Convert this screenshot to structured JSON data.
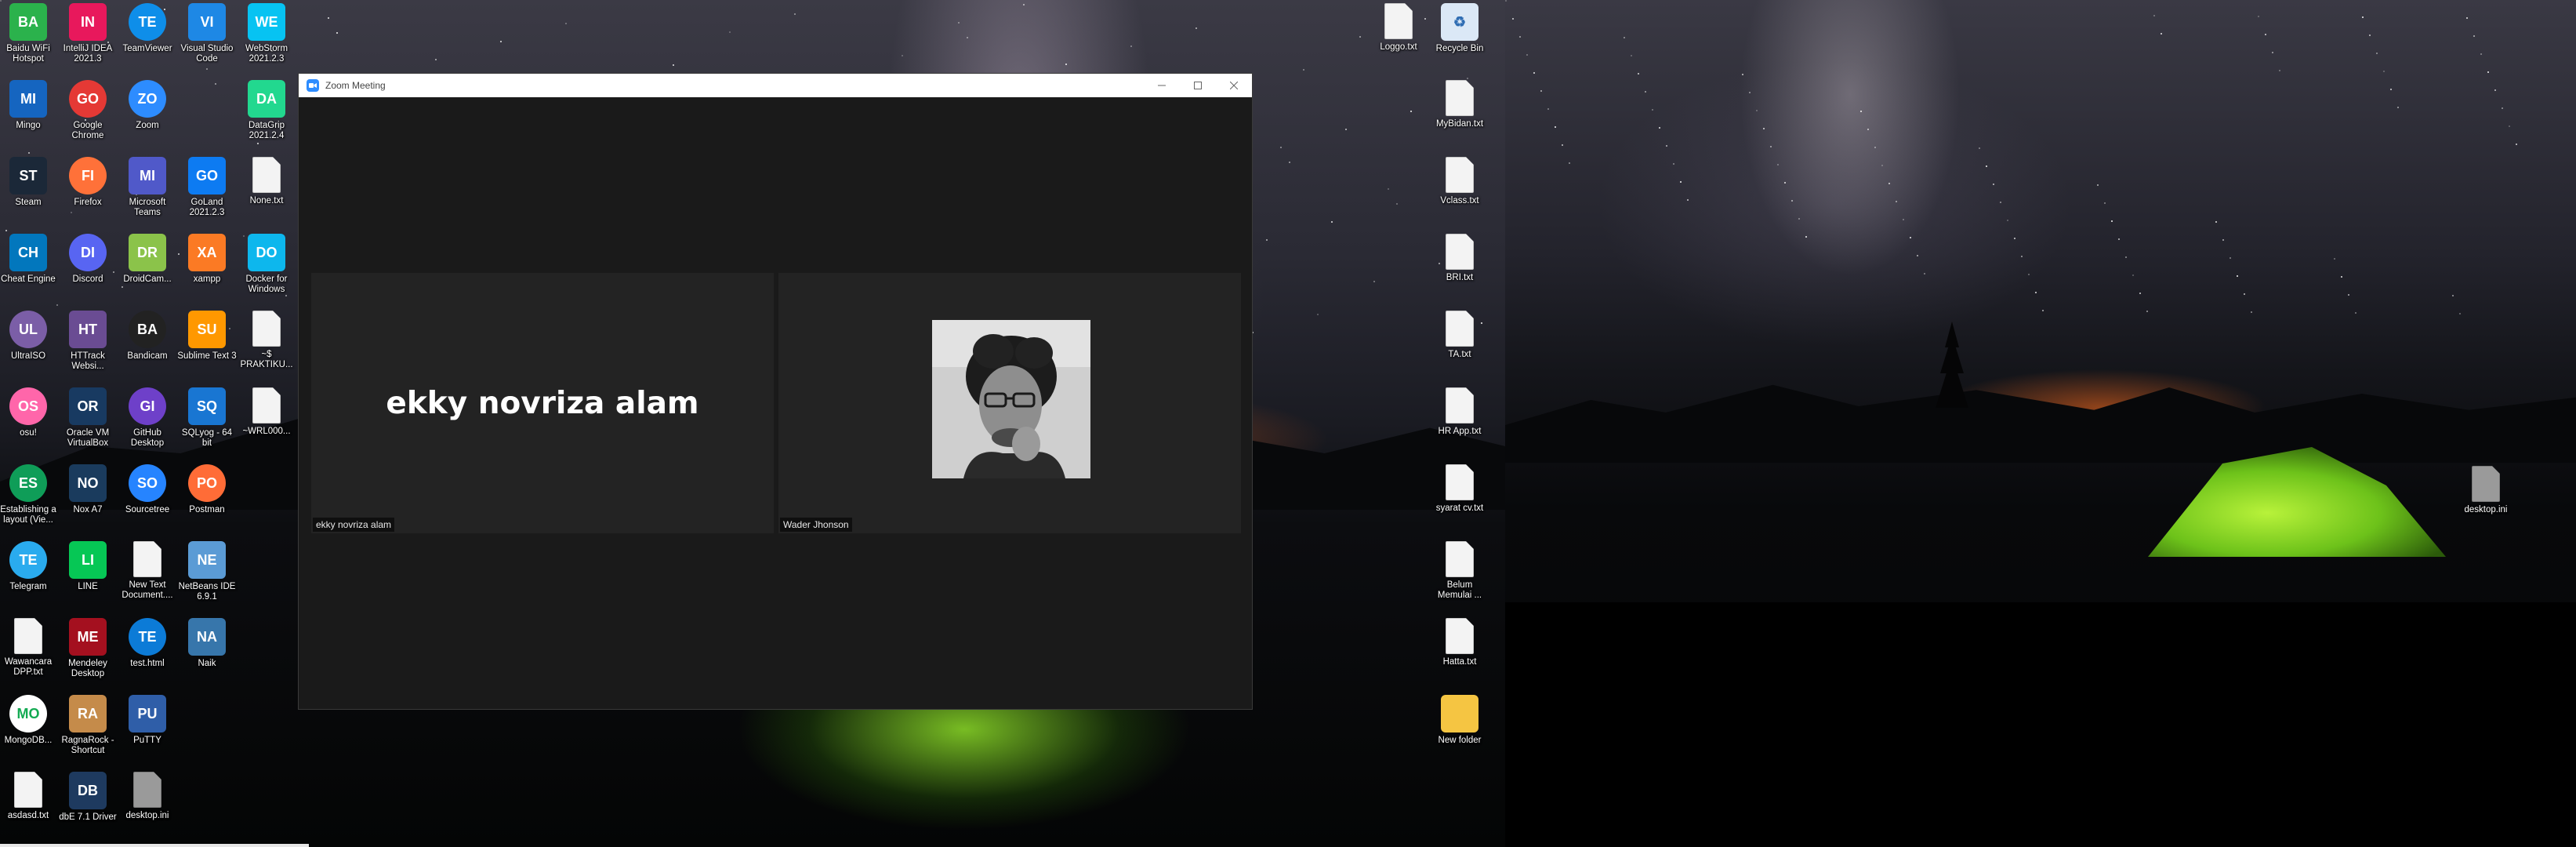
{
  "desktop_icons_left": [
    {
      "label": "Baidu WiFi Hotspot",
      "icon": "baidu-wifi-icon",
      "color": "#2bb24c"
    },
    {
      "label": "IntelliJ IDEA 2021.3",
      "icon": "intellij-icon",
      "color": "#e8185c"
    },
    {
      "label": "TeamViewer",
      "icon": "teamviewer-icon",
      "color": "#0e8ee9"
    },
    {
      "label": "Visual Studio Code",
      "icon": "vscode-icon",
      "color": "#1e88e5"
    },
    {
      "label": "WebStorm 2021.2.3",
      "icon": "webstorm-icon",
      "color": "#07c3f2"
    },
    {
      "label": "Mingo",
      "icon": "mingo-icon",
      "color": "#1565c0"
    },
    {
      "label": "Google Chrome",
      "icon": "chrome-icon",
      "color": "#e53935"
    },
    {
      "label": "Zoom",
      "icon": "zoom-icon",
      "color": "#2d8cff"
    },
    {
      "label": "DataGrip 2021.2.4",
      "icon": "datagrip-icon",
      "color": "#22d88f"
    },
    {
      "label": "Steam",
      "icon": "steam-icon",
      "color": "#1b2838"
    },
    {
      "label": "Firefox",
      "icon": "firefox-icon",
      "color": "#ff7139"
    },
    {
      "label": "Microsoft Teams",
      "icon": "teams-icon",
      "color": "#5059c9"
    },
    {
      "label": "GoLand 2021.2.3",
      "icon": "goland-icon",
      "color": "#0d7bf2"
    },
    {
      "label": "None.txt",
      "icon": "text-file-icon",
      "color": "#f3f3f3"
    },
    {
      "label": "Cheat Engine",
      "icon": "cheat-engine-icon",
      "color": "#0277bd"
    },
    {
      "label": "Discord",
      "icon": "discord-icon",
      "color": "#5865f2"
    },
    {
      "label": "DroidCam...",
      "icon": "droidcam-icon",
      "color": "#8bc34a"
    },
    {
      "label": "xampp",
      "icon": "xampp-icon",
      "color": "#fb7a24"
    },
    {
      "label": "Docker for Windows",
      "icon": "docker-icon",
      "color": "#0db7ed"
    },
    {
      "label": "UltraISO",
      "icon": "ultraiso-icon",
      "color": "#7b5ea7"
    },
    {
      "label": "HTTrack Websi...",
      "icon": "httrack-icon",
      "color": "#6a4c93"
    },
    {
      "label": "Bandicam",
      "icon": "bandicam-icon",
      "color": "#222222"
    },
    {
      "label": "Sublime Text 3",
      "icon": "sublime-icon",
      "color": "#ff9800"
    },
    {
      "label": "~$ PRAKTIKU...",
      "icon": "word-file-icon",
      "color": "#f3f3f3"
    },
    {
      "label": "osu!",
      "icon": "osu-icon",
      "color": "#ff66aa"
    },
    {
      "label": "Oracle VM VirtualBox",
      "icon": "virtualbox-icon",
      "color": "#183a61"
    },
    {
      "label": "GitHub Desktop",
      "icon": "github-icon",
      "color": "#6e40c9"
    },
    {
      "label": "SQLyog - 64 bit",
      "icon": "sqlyog-icon",
      "color": "#1976d2"
    },
    {
      "label": "~WRL000...",
      "icon": "file-icon",
      "color": "#f3f3f3"
    },
    {
      "label": "Establishing a layout (Vie...",
      "icon": "edge-icon",
      "color": "#0f9d58"
    },
    {
      "label": "Nox A7",
      "icon": "nox-icon",
      "color": "#1a3b5d"
    },
    {
      "label": "Sourcetree",
      "icon": "sourcetree-icon",
      "color": "#2684ff"
    },
    {
      "label": "Postman",
      "icon": "postman-icon",
      "color": "#ff6c37"
    },
    {
      "label": "Telegram",
      "icon": "telegram-icon",
      "color": "#2aabee"
    },
    {
      "label": "LINE",
      "icon": "line-icon",
      "color": "#06c755"
    },
    {
      "label": "New Text Document....",
      "icon": "text-file-icon",
      "color": "#f3f3f3"
    },
    {
      "label": "NetBeans IDE 6.9.1",
      "icon": "netbeans-icon",
      "color": "#5b9bd5"
    },
    {
      "label": "Wawancara DPP.txt",
      "icon": "text-file-icon",
      "color": "#f3f3f3"
    },
    {
      "label": "Mendeley Desktop",
      "icon": "mendeley-icon",
      "color": "#a4101f"
    },
    {
      "label": "test.html",
      "icon": "edge-html-icon",
      "color": "#0c7bd7"
    },
    {
      "label": "Naik",
      "icon": "python-icon",
      "color": "#3776ab"
    },
    {
      "label": "MongoDB...",
      "icon": "mongodb-icon",
      "color": "#ffffff"
    },
    {
      "label": "RagnaRock - Shortcut",
      "icon": "ragnarock-icon",
      "color": "#c58b4a"
    },
    {
      "label": "PuTTY",
      "icon": "putty-icon",
      "color": "#2f5ea8"
    },
    {
      "label": "asdasd.txt",
      "icon": "text-file-icon",
      "color": "#f3f3f3"
    },
    {
      "label": "dbE 7.1 Driver",
      "icon": "dbe-driver-icon",
      "color": "#1e3a5f"
    },
    {
      "label": "desktop.ini",
      "icon": "ini-file-icon",
      "color": "#9a9a9a"
    }
  ],
  "desktop_icons_right": [
    {
      "label": "Loggo.txt",
      "icon": "text-file-icon"
    },
    {
      "label": "Recycle Bin",
      "icon": "recycle-bin-icon"
    },
    {
      "label": "MyBidan.txt",
      "icon": "text-file-icon"
    },
    {
      "label": "Vclass.txt",
      "icon": "text-file-icon"
    },
    {
      "label": "BRI.txt",
      "icon": "text-file-icon"
    },
    {
      "label": "TA.txt",
      "icon": "text-file-icon"
    },
    {
      "label": "HR App.txt",
      "icon": "text-file-icon"
    },
    {
      "label": "syarat cv.txt",
      "icon": "text-file-icon"
    },
    {
      "label": "Belum Memulai ...",
      "icon": "text-file-icon"
    },
    {
      "label": "Hatta.txt",
      "icon": "text-file-icon"
    },
    {
      "label": "New folder",
      "icon": "folder-icon"
    },
    {
      "label": "desktop.ini",
      "icon": "ini-file-icon"
    }
  ],
  "zoom": {
    "title": "Zoom Meeting",
    "participants": [
      {
        "display_name": "ekky novriza alam",
        "tag": "ekky novriza alam",
        "video": false
      },
      {
        "display_name": "Wader Jhonson",
        "tag": "Wader Jhonson",
        "video": true
      }
    ]
  },
  "colors": {
    "zoom_blue": "#2d8cff",
    "zoom_bg": "#1a1a1a",
    "tile_bg": "#232323"
  }
}
